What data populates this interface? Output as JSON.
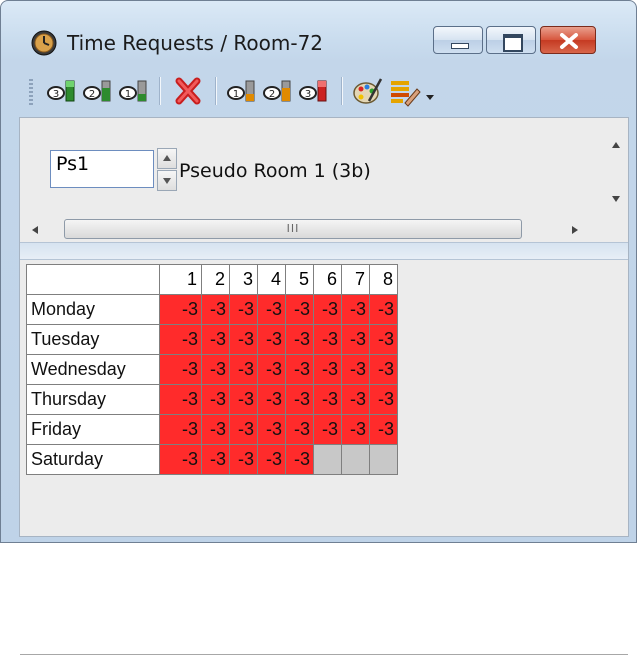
{
  "window": {
    "title": "Time Requests / Room-72",
    "icon": "clock-icon",
    "controls": [
      "minimize-icon",
      "maximize-icon",
      "close-icon"
    ]
  },
  "toolbar": {
    "groups": [
      [
        "priority-3-icon",
        "priority-2-icon",
        "priority-1-icon"
      ],
      [
        "delete-icon"
      ],
      [
        "priority-minus-1-icon",
        "priority-minus-2-icon",
        "priority-minus-3-icon"
      ],
      [
        "palette-icon",
        "edit-list-icon"
      ]
    ],
    "dropdown_icon": "dropdown-arrow-icon"
  },
  "room": {
    "code": "Ps1",
    "name": "Pseudo Room 1 (3b)"
  },
  "scroll": {
    "hthumb_grip": "III"
  },
  "grid": {
    "periods": [
      "1",
      "2",
      "3",
      "4",
      "5",
      "6",
      "7",
      "8"
    ],
    "rows": [
      {
        "day": "Monday",
        "cells": [
          "-3",
          "-3",
          "-3",
          "-3",
          "-3",
          "-3",
          "-3",
          "-3"
        ]
      },
      {
        "day": "Tuesday",
        "cells": [
          "-3",
          "-3",
          "-3",
          "-3",
          "-3",
          "-3",
          "-3",
          "-3"
        ]
      },
      {
        "day": "Wednesday",
        "cells": [
          "-3",
          "-3",
          "-3",
          "-3",
          "-3",
          "-3",
          "-3",
          "-3"
        ]
      },
      {
        "day": "Thursday",
        "cells": [
          "-3",
          "-3",
          "-3",
          "-3",
          "-3",
          "-3",
          "-3",
          "-3"
        ]
      },
      {
        "day": "Friday",
        "cells": [
          "-3",
          "-3",
          "-3",
          "-3",
          "-3",
          "-3",
          "-3",
          "-3"
        ]
      },
      {
        "day": "Saturday",
        "cells": [
          "-3",
          "-3",
          "-3",
          "-3",
          "-3",
          "",
          "",
          ""
        ]
      }
    ]
  },
  "colors": {
    "request_cell": "#ff2b2b",
    "unavailable_cell": "#c8c8c8"
  }
}
